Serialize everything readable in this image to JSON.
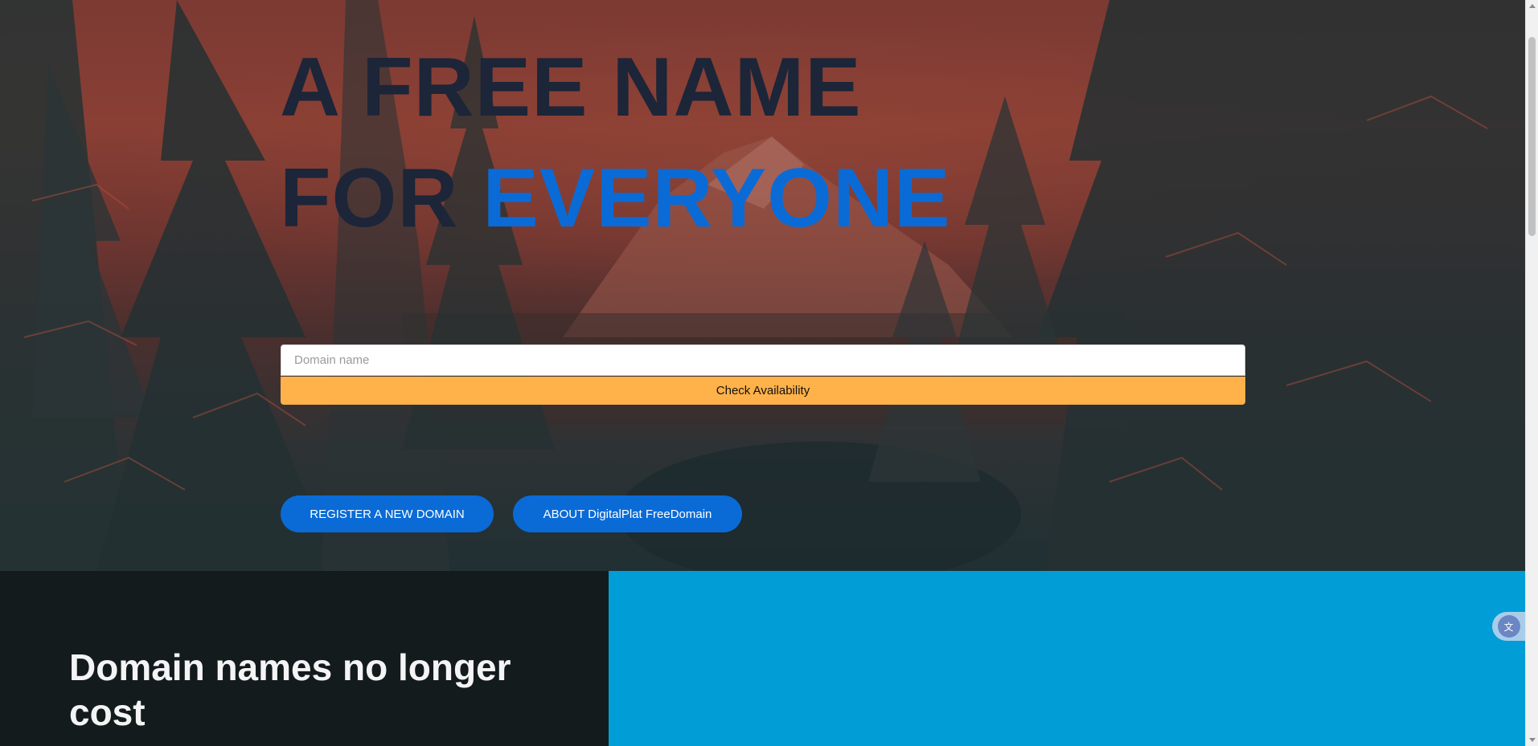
{
  "hero": {
    "headline_line1": "A FREE NAME",
    "headline_line2_plain": "FOR ",
    "headline_line2_accent": "EVERYONE"
  },
  "search": {
    "placeholder": "Domain name",
    "value": "",
    "check_label": "Check Availability"
  },
  "actions": {
    "register_label": "REGISTER A NEW DOMAIN",
    "about_label": "ABOUT DigitalPlat FreeDomain"
  },
  "feature": {
    "heading": "Domain names no longer cost"
  },
  "translate_widget": {
    "icon": "translate-icon"
  },
  "colors": {
    "accent_blue": "#0a6bd6",
    "check_button": "#ffb24a",
    "feature_panel": "#009dd6",
    "dark_panel": "#141b1d",
    "headline_dark": "#1d2538"
  }
}
